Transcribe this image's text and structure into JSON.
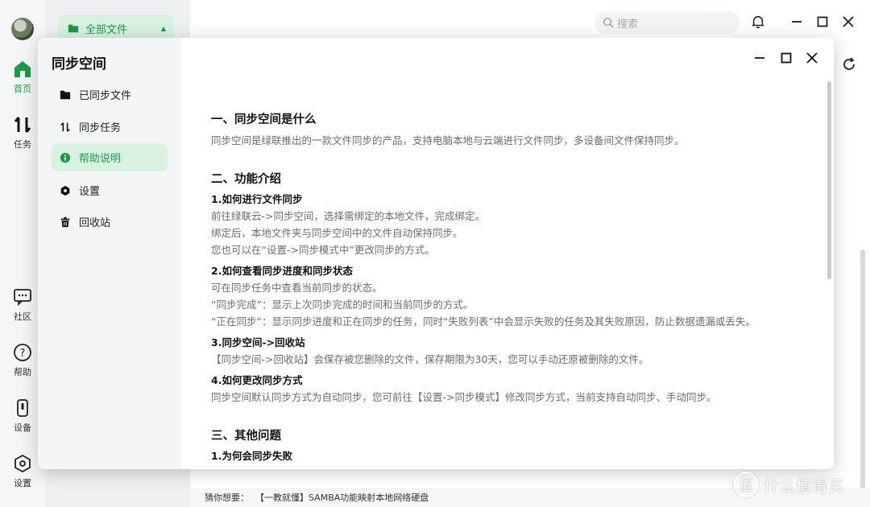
{
  "rail": {
    "items": [
      {
        "label": "首页",
        "icon": "home-icon"
      },
      {
        "label": "任务",
        "icon": "transfer-icon"
      },
      {
        "label": "社区",
        "icon": "chat-icon"
      },
      {
        "label": "帮助",
        "icon": "question-icon"
      },
      {
        "label": "设备",
        "icon": "device-icon"
      },
      {
        "label": "设置",
        "icon": "settings-hex-icon"
      }
    ]
  },
  "background": {
    "all_files_label": "全部文件",
    "search_placeholder": "搜索",
    "suggest_label": "猜你想要：",
    "suggest_link": "【一教就懂】SAMBA功能映射本地网络硬盘"
  },
  "watermark": {
    "text": "什么值得买",
    "mark": "值"
  },
  "dialog": {
    "title": "同步空间",
    "nav": [
      {
        "label": "已同步文件",
        "icon": "folder-icon"
      },
      {
        "label": "同步任务",
        "icon": "sync-arrows-icon"
      },
      {
        "label": "帮助说明",
        "icon": "info-icon"
      },
      {
        "label": "设置",
        "icon": "settings-hex-icon"
      },
      {
        "label": "回收站",
        "icon": "trash-icon"
      }
    ],
    "content": {
      "s1_title": "一、同步空间是什么",
      "s1_text": "同步空间是绿联推出的一款文件同步的产品，支持电脑本地与云端进行文件同步，多设备间文件保持同步。",
      "s2_title": "二、功能介绍",
      "q1_title": "1.如何进行文件同步",
      "q1_lines": [
        "前往绿联云->同步空间，选择需绑定的本地文件，完成绑定。",
        "绑定后，本地文件夹与同步空间中的文件自动保持同步。",
        "您也可以在“设置->同步模式中”更改同步的方式。"
      ],
      "q2_title": "2.如何查看同步进度和同步状态",
      "q2_lines": [
        "可在同步任务中查看当前同步的状态。",
        "“同步完成”：显示上次同步完成的时间和当前同步的方式。",
        "“正在同步”：显示同步进度和正在同步的任务，同时“失败列表”中会显示失败的任务及其失败原因，防止数据遗漏或丢失。"
      ],
      "q3_title": "3.同步空间->回收站",
      "q3_lines": [
        "【同步空间->回收站】会保存被您删除的文件，保存期限为30天，您可以手动还原被删除的文件。"
      ],
      "q4_title": "4.如何更改同步方式",
      "q4_lines": [
        "同步空间默认同步方式为自动同步，您可前往【设置->同步模式】修改同步方式，当前支持自动同步、手动同步。"
      ],
      "s3_title": "三、其他问题",
      "q5_title": "1.为何会同步失败"
    }
  },
  "colors": {
    "accent": "#1a9a47",
    "accent_bg": "#d9f1e1"
  }
}
